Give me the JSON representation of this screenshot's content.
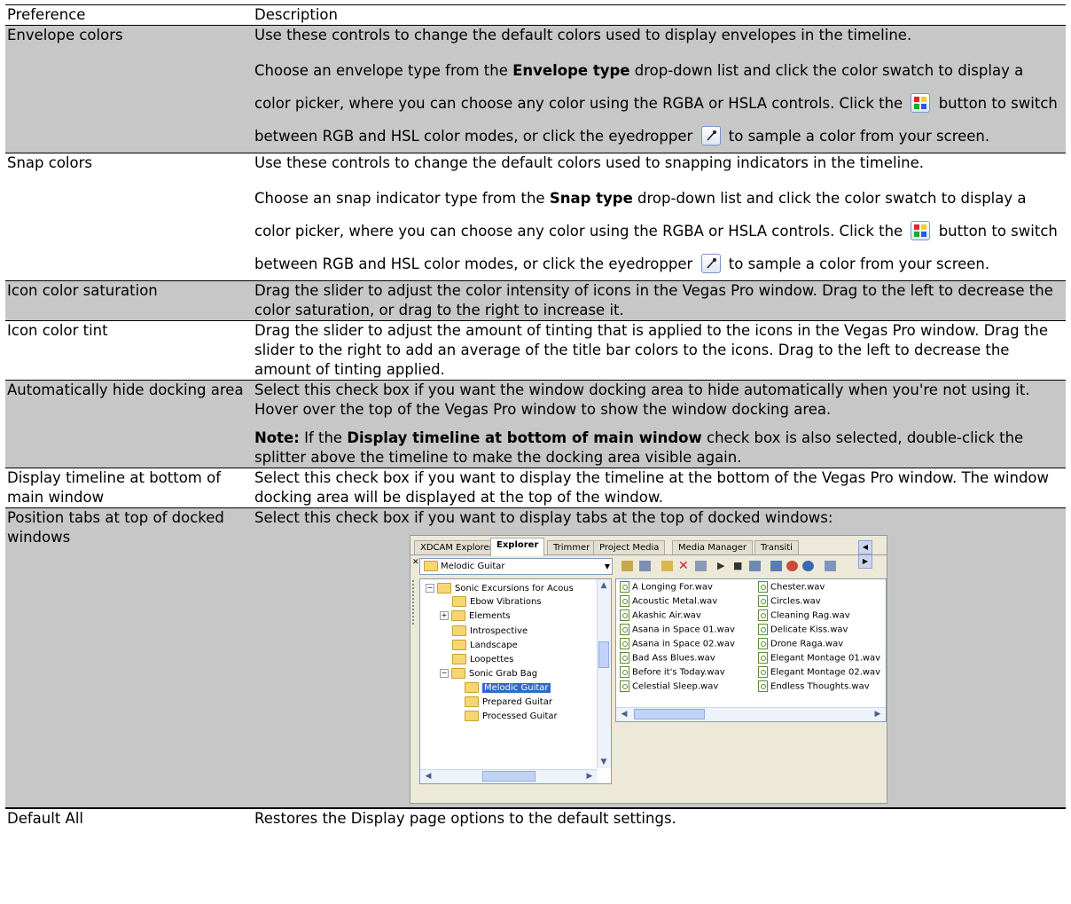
{
  "header": {
    "col1": "Preference",
    "col2": "Description"
  },
  "rows": {
    "envelope": {
      "name": "Envelope colors",
      "p1": "Use these controls to change the default colors used to display envelopes in the timeline.",
      "p2_a": "Choose an envelope type from the ",
      "p2_bold": "Envelope type",
      "p2_b": " drop-down list and click the color swatch to display a color picker, where you can choose any color using the RGBA or HSLA controls. Click the ",
      "p2_c": " button to switch between RGB and HSL color modes, or click the eyedropper ",
      "p2_d": " to sample a color from your screen."
    },
    "snap": {
      "name": "Snap colors",
      "p1": "Use these controls to change the default colors used to snapping indicators in the timeline.",
      "p2_a": "Choose an snap indicator type from the ",
      "p2_bold": "Snap type",
      "p2_b": " drop-down list and click the color swatch to display a color picker, where you can choose any color using the RGBA or HSLA controls. Click the ",
      "p2_c": " button to switch between RGB and HSL color modes, or click the eyedropper ",
      "p2_d": " to sample a color from your screen."
    },
    "saturation": {
      "name": "Icon color saturation",
      "desc": "Drag the slider to adjust the color intensity of icons in the Vegas Pro window. Drag to the left to decrease the color saturation, or drag to the right to increase it."
    },
    "tint": {
      "name": "Icon color tint",
      "desc": "Drag the slider to adjust the amount of tinting that is applied to the icons in the Vegas Pro window. Drag the slider to the right to add an average of the title bar colors to the icons. Drag to the left to decrease the amount of tinting applied."
    },
    "autohide": {
      "name": "Automatically hide docking area",
      "p1": "Select this check box if you want the window docking area to hide automatically when you're not using it. Hover over the top of the Vegas Pro window to show the window docking area.",
      "note_label": "Note:",
      "note_a": " If the ",
      "note_bold": "Display timeline at bottom of main window",
      "note_b": " check box is also selected, double-click the splitter above the timeline to make the docking area visible again."
    },
    "bottom": {
      "name": "Display timeline at bottom of main window",
      "desc": "Select this check box if you want to display the timeline at the bottom of the Vegas Pro window. The window docking area will be displayed at the top of the window."
    },
    "tabs": {
      "name": "Position tabs at top of docked windows",
      "desc": "Select this check box if you want to display tabs at the top of docked windows:"
    },
    "default": {
      "name": "Default All",
      "desc": "Restores the Display page options to the default settings."
    }
  },
  "explorer": {
    "tabs": [
      "XDCAM Explorer",
      "Explorer",
      "Trimmer",
      "Project Media",
      "Media Manager",
      "Transiti"
    ],
    "active_tab": "Explorer",
    "path": "Melodic Guitar",
    "tree": [
      "Sonic Excursions for Acous",
      "Ebow Vibrations",
      "Elements",
      "Introspective",
      "Landscape",
      "Loopettes",
      "Sonic Grab Bag",
      "Melodic Guitar",
      "Prepared Guitar",
      "Processed Guitar"
    ],
    "files_col1": [
      "A Longing For.wav",
      "Acoustic Metal.wav",
      "Akashic Air.wav",
      "Asana in Space 01.wav",
      "Asana in Space 02.wav",
      "Bad Ass Blues.wav",
      "Before it's Today.wav",
      "Celestial Sleep.wav"
    ],
    "files_col2": [
      "Chester.wav",
      "Circles.wav",
      "Cleaning Rag.wav",
      "Delicate Kiss.wav",
      "Drone Raga.wav",
      "Elegant Montage 01.wav",
      "Elegant Montage 02.wav",
      "Endless Thoughts.wav"
    ]
  },
  "colors": {
    "shade": "#c7c7c7",
    "selection": "#316ac5"
  },
  "icons": [
    "color-mode-button-icon",
    "eyedropper-icon",
    "folder-icon",
    "wav-file-icon"
  ]
}
